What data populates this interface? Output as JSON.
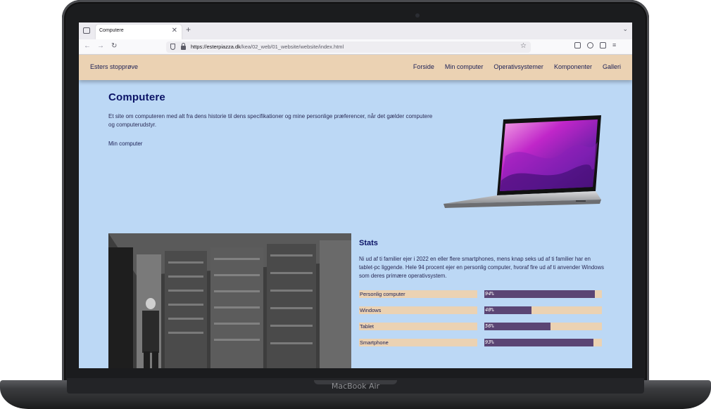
{
  "device": {
    "model": "MacBook Air"
  },
  "browser": {
    "tab_title": "Computere",
    "tab_close": "✕",
    "new_tab": "+",
    "url_host": "https://esterpiazza.dk",
    "url_path": "/kea/02_web/01_website/website/index.html",
    "back": "←",
    "forward": "→",
    "reload": "↻"
  },
  "site": {
    "logo": "Esters stopprøve",
    "nav": [
      "Forside",
      "Min computer",
      "Operativsystemer",
      "Komponenter",
      "Galleri"
    ]
  },
  "hero": {
    "title": "Computere",
    "text": "Et site om computeren med alt fra dens historie til dens specifikationer og mine personlige præferencer, når det gælder computere og computerudstyr.",
    "link": "Min computer"
  },
  "stats": {
    "title": "Stats",
    "text": "Ni ud af ti familier ejer i 2022 en eller flere smartphones, mens knap seks ud af ti familier har en tablet-pc liggende. Hele 94 procent ejer en personlig computer, hvoraf fire ud af ti anvender Windows som deres primære operativsystem.",
    "rows": [
      {
        "label": "Personlig computer",
        "value": "94%",
        "percent": 94
      },
      {
        "label": "Windows",
        "value": "40%",
        "percent": 40
      },
      {
        "label": "Tablet",
        "value": "56%",
        "percent": 56
      },
      {
        "label": "Smartphone",
        "value": "93%",
        "percent": 93
      }
    ]
  },
  "colors": {
    "page_background": "#bcd8f5",
    "header_background": "#ebd2b3",
    "heading": "#0b1366",
    "bar_fill": "#5b4574"
  }
}
